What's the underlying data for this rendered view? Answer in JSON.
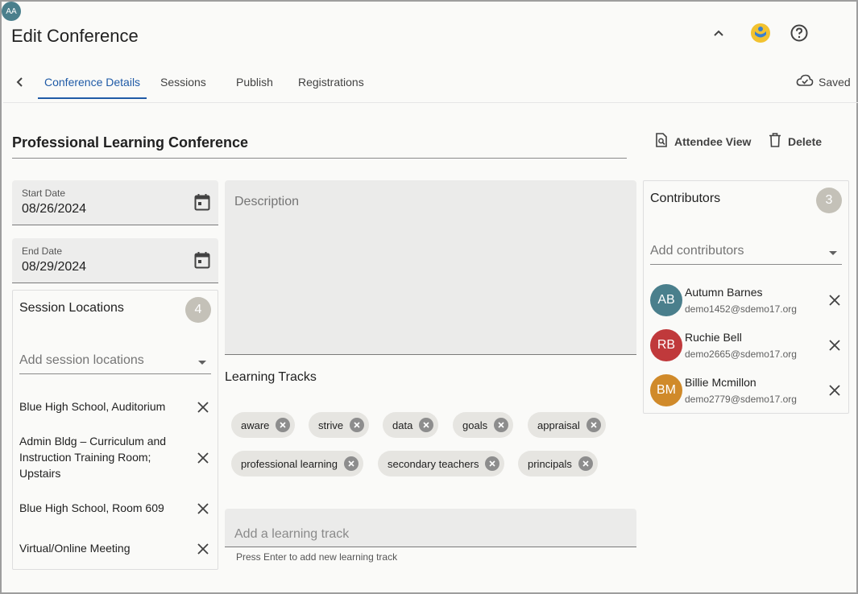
{
  "header": {
    "title": "Edit Conference",
    "avatar_initials": "AA",
    "avatar_color": "#4a7f8c"
  },
  "tabs": [
    {
      "label": "Conference Details",
      "active": true
    },
    {
      "label": "Sessions",
      "active": false
    },
    {
      "label": "Publish",
      "active": false
    },
    {
      "label": "Registrations",
      "active": false
    }
  ],
  "status": {
    "saved_label": "Saved",
    "icon": "cloud-check-icon"
  },
  "conference": {
    "title": "Professional Learning Conference",
    "attendee_view_label": "Attendee View",
    "delete_label": "Delete",
    "start_date": {
      "label": "Start Date",
      "value": "08/26/2024"
    },
    "end_date": {
      "label": "End Date",
      "value": "08/29/2024"
    },
    "description_placeholder": "Description"
  },
  "locations": {
    "title": "Session Locations",
    "count": "4",
    "add_placeholder": "Add session locations",
    "items": [
      "Blue High School, Auditorium",
      "Admin Bldg – Curriculum and Instruction Training Room; Upstairs",
      "Blue High School, Room 609",
      "Virtual/Online Meeting"
    ]
  },
  "learning_tracks": {
    "label": "Learning Tracks",
    "chips": [
      "aware",
      "strive",
      "data",
      "goals",
      "appraisal",
      "professional learning",
      "secondary teachers",
      "principals"
    ],
    "add_placeholder": "Add a learning track",
    "hint": "Press Enter to add new learning track"
  },
  "contributors": {
    "title": "Contributors",
    "count": "3",
    "add_placeholder": "Add contributors",
    "people": [
      {
        "initials": "AB",
        "name": "Autumn Barnes",
        "email": "demo1452@sdemo17.org",
        "color": "#4a7f8c"
      },
      {
        "initials": "RB",
        "name": "Ruchie Bell",
        "email": "demo2665@sdemo17.org",
        "color": "#c0393b"
      },
      {
        "initials": "BM",
        "name": "Billie Mcmillon",
        "email": "demo2779@sdemo17.org",
        "color": "#d08a2a"
      }
    ]
  },
  "colors": {
    "accent": "#1f5aa6",
    "badge": "#c4c1b8"
  }
}
